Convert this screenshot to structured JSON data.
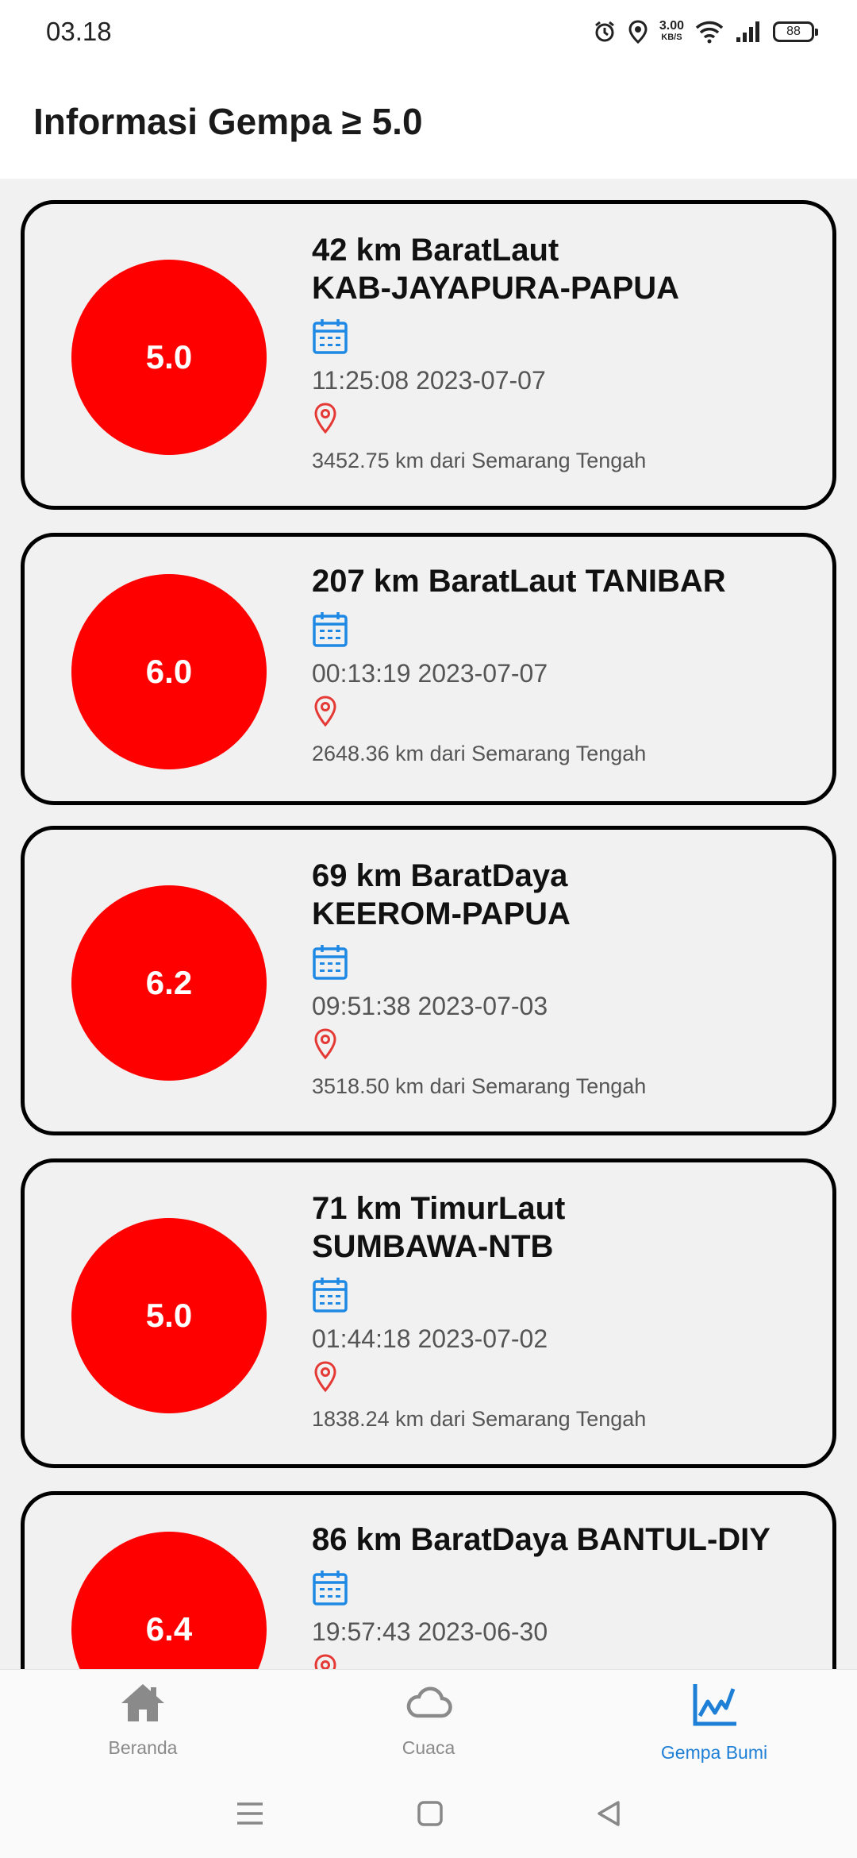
{
  "status_bar": {
    "time": "03.18",
    "net_speed_value": "3.00",
    "net_speed_unit": "KB/S",
    "battery": "88"
  },
  "header": {
    "title": "Informasi Gempa ≥ 5.0"
  },
  "colors": {
    "magnitude_circle": "#ff0000",
    "calendar_icon": "#1e88e5",
    "location_icon": "#e53935",
    "active_nav": "#1e7fd6",
    "inactive_nav": "#8a8a8a"
  },
  "quakes": [
    {
      "magnitude": "5.0",
      "place_line1": "42 km BaratLaut",
      "place_line2": "KAB-JAYAPURA-PAPUA",
      "datetime": "11:25:08 2023-07-07",
      "distance": "3452.75 km dari Semarang Tengah"
    },
    {
      "magnitude": "6.0",
      "place_line1": "207 km BaratLaut TANIBAR",
      "place_line2": "",
      "datetime": "00:13:19 2023-07-07",
      "distance": "2648.36 km dari Semarang Tengah"
    },
    {
      "magnitude": "6.2",
      "place_line1": "69 km BaratDaya",
      "place_line2": "KEEROM-PAPUA",
      "datetime": "09:51:38 2023-07-03",
      "distance": "3518.50 km dari Semarang Tengah"
    },
    {
      "magnitude": "5.0",
      "place_line1": "71 km TimurLaut",
      "place_line2": "SUMBAWA-NTB",
      "datetime": "01:44:18 2023-07-02",
      "distance": "1838.24 km dari Semarang Tengah"
    },
    {
      "magnitude": "6.4",
      "place_line1": "86 km BaratDaya BANTUL-DIY",
      "place_line2": "",
      "datetime": "19:57:43 2023-06-30",
      "distance": ""
    }
  ],
  "bottom_nav": {
    "items": [
      {
        "label": "Beranda",
        "icon": "home-icon"
      },
      {
        "label": "Cuaca",
        "icon": "cloud-icon"
      },
      {
        "label": "Gempa Bumi",
        "icon": "chart-line-icon"
      }
    ],
    "active": "Gempa Bumi"
  }
}
